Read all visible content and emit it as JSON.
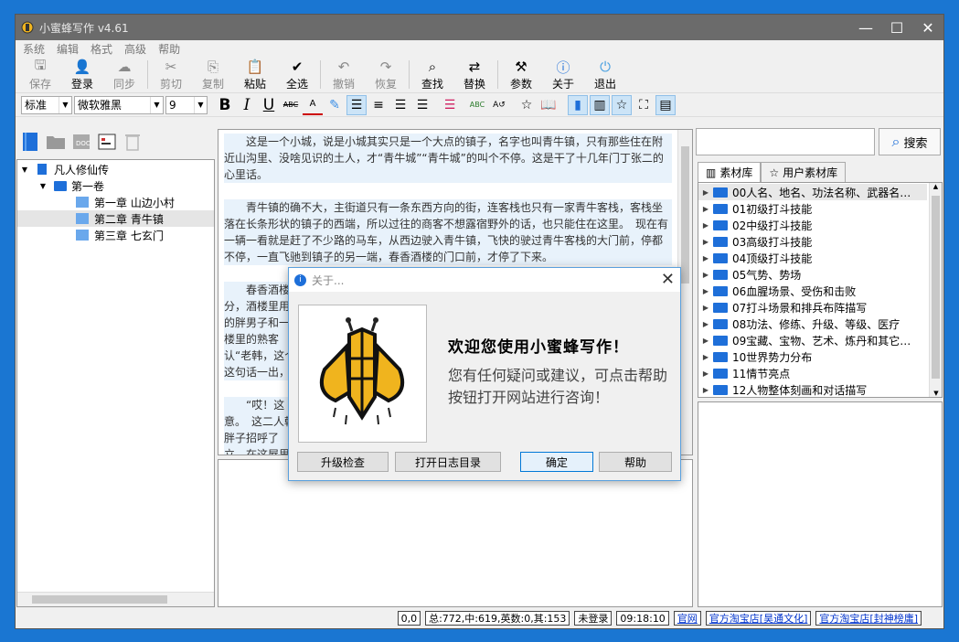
{
  "window": {
    "title": "小蜜蜂写作 v4.61"
  },
  "menu": [
    "系统",
    "编辑",
    "格式",
    "高级",
    "帮助"
  ],
  "toolbar": [
    {
      "label": "保存",
      "icon": "save-icon",
      "disabled": true,
      "glyph": "🖫"
    },
    {
      "label": "登录",
      "icon": "user-icon",
      "disabled": false,
      "glyph": "👤"
    },
    {
      "label": "同步",
      "icon": "cloud-sync-icon",
      "disabled": true,
      "glyph": "☁"
    },
    {
      "label": "剪切",
      "icon": "scissors-icon",
      "disabled": true,
      "glyph": "✂"
    },
    {
      "label": "复制",
      "icon": "copy-icon",
      "disabled": true,
      "glyph": "⎘"
    },
    {
      "label": "粘贴",
      "icon": "clipboard-icon",
      "disabled": false,
      "glyph": "📋"
    },
    {
      "label": "全选",
      "icon": "check-all-icon",
      "disabled": false,
      "glyph": "✔"
    },
    {
      "label": "撤销",
      "icon": "undo-icon",
      "disabled": true,
      "glyph": "↶"
    },
    {
      "label": "恢复",
      "icon": "redo-icon",
      "disabled": true,
      "glyph": "↷"
    },
    {
      "label": "查找",
      "icon": "search-icon",
      "disabled": false,
      "glyph": "⌕"
    },
    {
      "label": "替换",
      "icon": "replace-icon",
      "disabled": false,
      "glyph": "⇄"
    },
    {
      "label": "参数",
      "icon": "tools-icon",
      "disabled": false,
      "glyph": "⚒"
    },
    {
      "label": "关于",
      "icon": "info-icon",
      "disabled": false,
      "glyph": "ⓘ"
    },
    {
      "label": "退出",
      "icon": "exit-icon",
      "disabled": false,
      "glyph": "⏻"
    }
  ],
  "format": {
    "style": "标准",
    "font": "微软雅黑",
    "size": "9"
  },
  "tree": {
    "book": "凡人修仙传",
    "volume": "第一卷",
    "chapters": [
      "第一章 山边小村",
      "第二章 青牛镇",
      "第三章 七玄门"
    ]
  },
  "editor": {
    "paragraphs": [
      "　　这是一个小城，说是小城其实只是一个大点的镇子，名字也叫青牛镇，只有那些住在附近山沟里、没啥见识的土人，才“青牛城”“青牛城”的叫个不停。这是干了十几年门丁张二的心里话。",
      "　　青牛镇的确不大，主街道只有一条东西方向的街，连客栈也只有一家青牛客栈，客栈坐落在长条形状的镇子的西端，所以过往的商客不想露宿野外的话，也只能住在这里。　现在有一辆一看就是赶了不少路的马车，从西边驶入青牛镇，飞快的驶过青牛客栈的大门前，停都不停，一直飞驰到镇子的另一端，春香酒楼的门口前，才停了下来。",
      "　　春香酒楼分，酒楼里用的胖男子和一楼里的熟客认“老韩，这个这句话一出，",
      "　　“哎！这意。　这二人韩胖子招呼了立，在这屋里呼几位熟客，"
    ]
  },
  "search": {
    "placeholder": "",
    "button": "搜索"
  },
  "tabs": [
    "素材库",
    "用户素材库"
  ],
  "library": [
    "00人名、地名、功法名称、武器名…",
    "01初级打斗技能",
    "02中级打斗技能",
    "03高级打斗技能",
    "04顶级打斗技能",
    "05气势、势场",
    "06血腥场景、受伤和击败",
    "07打斗场景和排兵布阵描写",
    "08功法、修练、升级、等级、医疗",
    "09宝藏、宝物、艺术、炼丹和其它…",
    "10世界势力分布",
    "11情节亮点",
    "12人物整体刻画和对话描写"
  ],
  "status": {
    "cursor": "0,0",
    "counts": "总:772,中:619,英数:0,其:153",
    "login": "未登录",
    "time": "09:18:10",
    "links": [
      "官网",
      "官方淘宝店[昊通文化]",
      "官方淘宝店[封神榜庸]"
    ]
  },
  "dialog": {
    "title": "关于...",
    "welcome": "欢迎您使用小蜜蜂写作！",
    "message": "您有任何疑问或建议，可点击帮助按钮打开网站进行咨询！",
    "buttons": [
      "升级检查",
      "打开日志目录",
      "确定",
      "帮助"
    ]
  },
  "colors": {
    "accent": "#1e6fd9",
    "titlebar": "#6b6b6b",
    "bee": "#f0b41e"
  }
}
